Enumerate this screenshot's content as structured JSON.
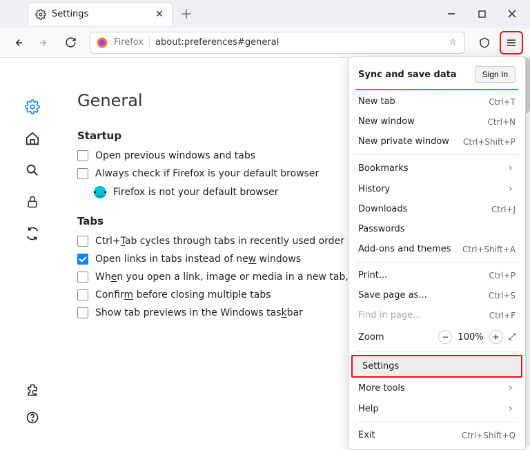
{
  "tab": {
    "title": "Settings"
  },
  "urlbar": {
    "label": "Firefox",
    "address": "about:preferences#general"
  },
  "page": {
    "heading": "General",
    "startup_heading": "Startup",
    "chk_prev": "Open previous windows and tabs",
    "chk_default": "Always check if Firefox is your default browser",
    "default_status": "Firefox is not your default browser",
    "tabs_heading": "Tabs",
    "chk_ctrltab_a": "Ctrl+",
    "chk_ctrltab_u": "T",
    "chk_ctrltab_b": "ab cycles through tabs in recently used order",
    "chk_links_a": "Open links in tabs instead of ne",
    "chk_links_u": "w",
    "chk_links_b": " windows",
    "chk_switch_a": "Wh",
    "chk_switch_u": "e",
    "chk_switch_b": "n you open a link, image or media in a new tab, switch t",
    "chk_confirm_a": "Confir",
    "chk_confirm_u": "m",
    "chk_confirm_b": " before closing multiple tabs",
    "chk_preview_a": "Show tab previews in the Windows tas",
    "chk_preview_u": "k",
    "chk_preview_b": "bar"
  },
  "menu": {
    "sync_label": "Sync and save data",
    "signin": "Sign In",
    "items": [
      {
        "label": "New tab",
        "shortcut": "Ctrl+T"
      },
      {
        "label": "New window",
        "shortcut": "Ctrl+N"
      },
      {
        "label": "New private window",
        "shortcut": "Ctrl+Shift+P"
      }
    ],
    "items2": [
      {
        "label": "Bookmarks",
        "arrow": true
      },
      {
        "label": "History",
        "arrow": true
      },
      {
        "label": "Downloads",
        "shortcut": "Ctrl+J"
      },
      {
        "label": "Passwords"
      },
      {
        "label": "Add-ons and themes",
        "shortcut": "Ctrl+Shift+A"
      }
    ],
    "items3": [
      {
        "label": "Print...",
        "shortcut": "Ctrl+P"
      },
      {
        "label": "Save page as...",
        "shortcut": "Ctrl+S"
      },
      {
        "label": "Find in page...",
        "shortcut": "Ctrl+F",
        "disabled": true
      }
    ],
    "zoom_label": "Zoom",
    "zoom_value": "100%",
    "settings": "Settings",
    "more_tools": "More tools",
    "help": "Help",
    "exit": "Exit",
    "exit_shortcut": "Ctrl+Shift+Q"
  }
}
